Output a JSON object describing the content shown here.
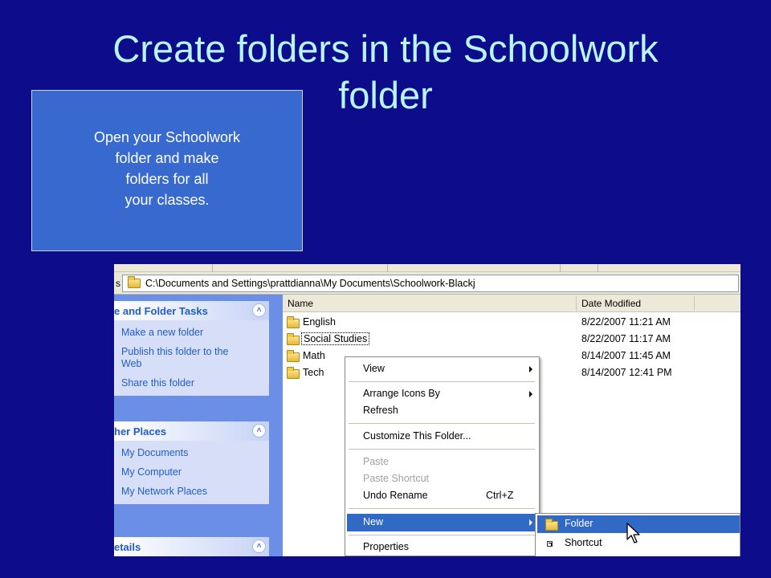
{
  "slide": {
    "title_line1": "Create folders in the Schoolwork",
    "title_line2": "folder",
    "callout_lines": [
      "Open your Schoolwork",
      "folder and make",
      "folders for all",
      "your classes."
    ]
  },
  "explorer": {
    "address_label": "s",
    "address_path": "C:\\Documents and Settings\\prattdianna\\My Documents\\Schoolwork-Blackj",
    "task_groups": [
      {
        "title": "e and Folder Tasks",
        "links": [
          "Make a new folder",
          "Publish this folder to the Web",
          "Share this folder"
        ]
      },
      {
        "title": "her Places",
        "links": [
          "My Documents",
          "My Computer",
          "My Network Places"
        ]
      },
      {
        "title": "etails",
        "links": []
      }
    ],
    "columns": {
      "name": "Name",
      "date": "Date Modified"
    },
    "files": [
      {
        "name": "English",
        "date": "8/22/2007 11:21 AM"
      },
      {
        "name": "Social Studies",
        "date": "8/22/2007 11:17 AM"
      },
      {
        "name": "Math",
        "date": "8/14/2007 11:45 AM"
      },
      {
        "name": "Tech",
        "date": "8/14/2007 12:41 PM"
      }
    ],
    "context_menu": {
      "view": "View",
      "arrange": "Arrange Icons By",
      "refresh": "Refresh",
      "customize": "Customize This Folder...",
      "paste": "Paste",
      "paste_shortcut": "Paste Shortcut",
      "undo": "Undo Rename",
      "undo_key": "Ctrl+Z",
      "new": "New",
      "properties": "Properties"
    },
    "submenu": {
      "folder": "Folder",
      "shortcut": "Shortcut"
    },
    "colors": {
      "slide_bg": "#0d0d8c",
      "title": "#b9f5ff",
      "callout_bg": "#3769cf",
      "highlight": "#316ac5",
      "link": "#215dc6"
    }
  }
}
